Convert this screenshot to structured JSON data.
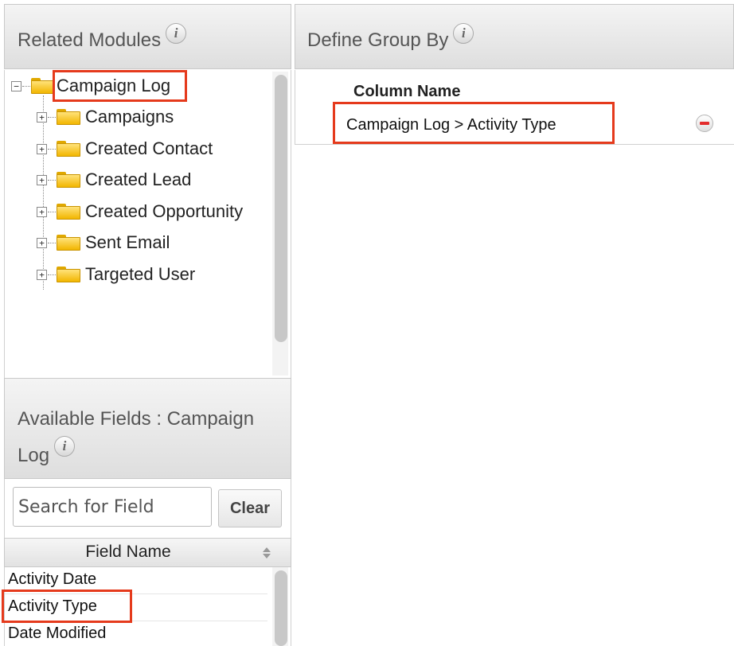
{
  "related_modules": {
    "title": "Related Modules",
    "info_icon": "info-icon",
    "root": {
      "label": "Campaign Log",
      "icon": "open-folder-icon",
      "toggle": "−"
    },
    "children": [
      {
        "label": "Campaigns",
        "toggle": "+"
      },
      {
        "label": "Created Contact",
        "toggle": "+"
      },
      {
        "label": "Created Lead",
        "toggle": "+"
      },
      {
        "label": "Created Opportunity",
        "toggle": "+"
      },
      {
        "label": "Sent Email",
        "toggle": "+"
      },
      {
        "label": "Targeted User",
        "toggle": "+"
      }
    ]
  },
  "available_fields": {
    "title_line1": "Available Fields : Campaign",
    "title_line2": "Log",
    "info_icon": "info-icon",
    "search_placeholder": "Search for Field",
    "clear_label": "Clear",
    "column_header": "Field Name",
    "sort_icon": "sort-arrows-icon",
    "fields": [
      "Activity Date",
      "Activity Type",
      "Date Modified"
    ]
  },
  "group_by": {
    "title": "Define Group By",
    "info_icon": "info-icon",
    "column_header": "Column Name",
    "rows": [
      {
        "label": "Campaign Log > Activity Type",
        "remove_icon": "remove-icon"
      }
    ]
  },
  "colors": {
    "highlight": "#e53a1c",
    "remove": "#e32b2b",
    "folder": "#f2b600"
  }
}
